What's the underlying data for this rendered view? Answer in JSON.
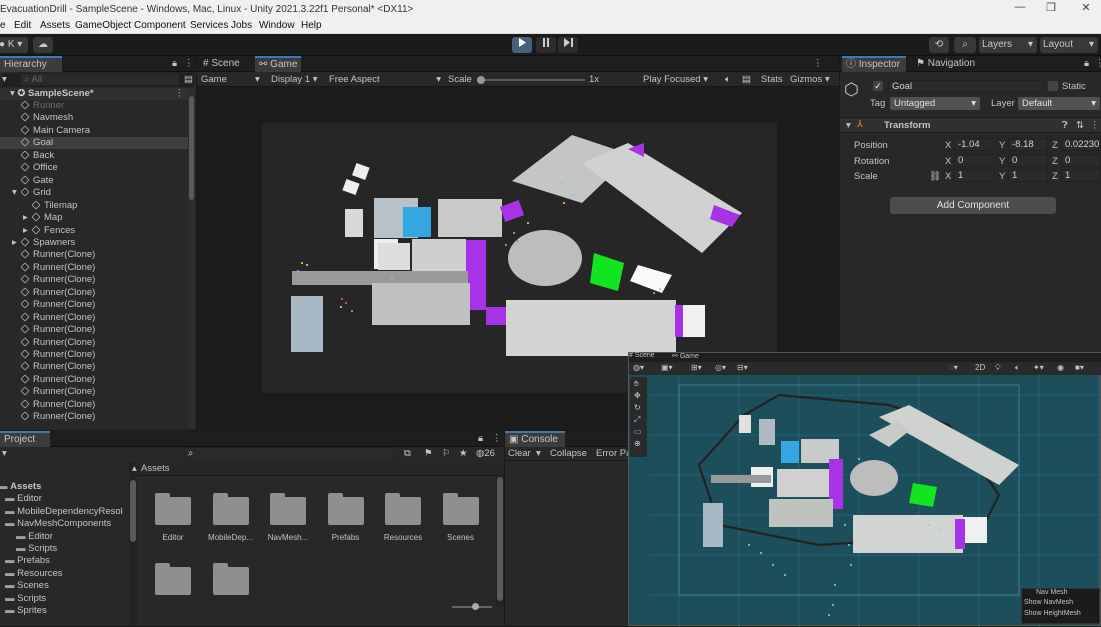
{
  "window": {
    "title": "EvacuationDrill - SampleScene - Windows, Mac, Linux - Unity 2021.3.22f1 Personal* <DX11>",
    "controls": [
      "—",
      "❐",
      "✕"
    ]
  },
  "menu": [
    "e",
    "Edit",
    "Assets",
    "GameObject",
    "Component",
    "Services",
    "Jobs",
    "Window",
    "Help"
  ],
  "toolbar": {
    "account": "K",
    "layers": "Layers",
    "layout": "Layout"
  },
  "hierarchy": {
    "tab": "Hierarchy",
    "search_placeholder": "All",
    "scene": "SampleScene*",
    "items": [
      {
        "label": "Runner",
        "indent": 1,
        "disabled": true
      },
      {
        "label": "Navmesh",
        "indent": 1
      },
      {
        "label": "Main Camera",
        "indent": 1
      },
      {
        "label": "Goal",
        "indent": 1,
        "selected": true
      },
      {
        "label": "Back",
        "indent": 1
      },
      {
        "label": "Office",
        "indent": 1
      },
      {
        "label": "Gate",
        "indent": 1
      },
      {
        "label": "Grid",
        "indent": 1,
        "expanded": true
      },
      {
        "label": "Tilemap",
        "indent": 2
      },
      {
        "label": "Map",
        "indent": 2,
        "collapsed": true
      },
      {
        "label": "Fences",
        "indent": 2,
        "collapsed": true
      },
      {
        "label": "Spawners",
        "indent": 1,
        "collapsed": true
      },
      {
        "label": "Runner(Clone)",
        "indent": 1
      },
      {
        "label": "Runner(Clone)",
        "indent": 1
      },
      {
        "label": "Runner(Clone)",
        "indent": 1
      },
      {
        "label": "Runner(Clone)",
        "indent": 1
      },
      {
        "label": "Runner(Clone)",
        "indent": 1
      },
      {
        "label": "Runner(Clone)",
        "indent": 1
      },
      {
        "label": "Runner(Clone)",
        "indent": 1
      },
      {
        "label": "Runner(Clone)",
        "indent": 1
      },
      {
        "label": "Runner(Clone)",
        "indent": 1
      },
      {
        "label": "Runner(Clone)",
        "indent": 1
      },
      {
        "label": "Runner(Clone)",
        "indent": 1
      },
      {
        "label": "Runner(Clone)",
        "indent": 1
      },
      {
        "label": "Runner(Clone)",
        "indent": 1
      },
      {
        "label": "Runner(Clone)",
        "indent": 1
      }
    ]
  },
  "view_tabs": {
    "scene": "Scene",
    "game": "Game"
  },
  "game_bar": {
    "mode": "Game",
    "display": "Display 1",
    "aspect": "Free Aspect",
    "scale_label": "Scale",
    "scale_value": "1x",
    "play_focused": "Play Focused",
    "stats": "Stats",
    "gizmos": "Gizmos"
  },
  "inspector": {
    "tab": "Inspector",
    "tab2": "Navigation",
    "object_name": "Goal",
    "static_label": "Static",
    "tag_label": "Tag",
    "tag_value": "Untagged",
    "layer_label": "Layer",
    "layer_value": "Default",
    "component": "Transform",
    "position_label": "Position",
    "rotation_label": "Rotation",
    "scale_label": "Scale",
    "position": {
      "x": "-1.04",
      "y": "-8.18",
      "z": "0.02230"
    },
    "rotation": {
      "x": "0",
      "y": "0",
      "z": "0"
    },
    "scale": {
      "x": "1",
      "y": "1",
      "z": "1"
    },
    "add_component": "Add Component"
  },
  "project": {
    "tab": "Project",
    "hidden_count": "26",
    "tree": [
      {
        "label": "Assets",
        "indent": 0,
        "bold": true
      },
      {
        "label": "Editor",
        "indent": 1
      },
      {
        "label": "MobileDependencyResol",
        "indent": 1
      },
      {
        "label": "NavMeshComponents",
        "indent": 1
      },
      {
        "label": "Editor",
        "indent": 2
      },
      {
        "label": "Scripts",
        "indent": 2
      },
      {
        "label": "Prefabs",
        "indent": 1
      },
      {
        "label": "Resources",
        "indent": 1
      },
      {
        "label": "Scenes",
        "indent": 1
      },
      {
        "label": "Scripts",
        "indent": 1
      },
      {
        "label": "Sprites",
        "indent": 1
      }
    ],
    "breadcrumb": "Assets",
    "folders": [
      "Editor",
      "MobileDep...",
      "NavMesh...",
      "Prefabs",
      "Resources",
      "Scenes",
      "",
      ""
    ]
  },
  "console": {
    "tab": "Console",
    "clear": "Clear",
    "collapse": "Collapse",
    "error_pause": "Error Pa"
  },
  "scene_overlay": {
    "tab_scene": "Scene",
    "tab_game": "Game",
    "toggle_2d": "2D",
    "navmesh_title": "Nav Mesh",
    "show_navmesh": "Show NavMesh",
    "show_heightmesh": "Show HeightMesh"
  }
}
